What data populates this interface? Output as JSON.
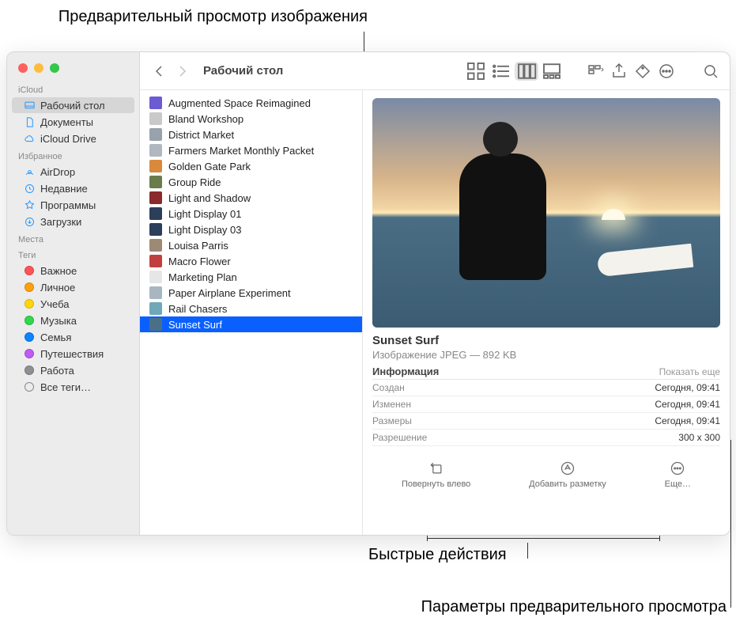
{
  "annotations": {
    "preview": "Предварительный просмотр изображения",
    "quick_actions": "Быстрые действия",
    "preview_options": "Параметры предварительного просмотра"
  },
  "toolbar": {
    "title": "Рабочий стол"
  },
  "sidebar": {
    "sections": {
      "icloud": {
        "label": "iCloud",
        "items": [
          "Рабочий стол",
          "Документы",
          "iCloud Drive"
        ]
      },
      "favorites": {
        "label": "Избранное",
        "items": [
          "AirDrop",
          "Недавние",
          "Программы",
          "Загрузки"
        ]
      },
      "places": {
        "label": "Места"
      },
      "tags": {
        "label": "Теги",
        "items": [
          "Важное",
          "Личное",
          "Учеба",
          "Музыка",
          "Семья",
          "Путешествия",
          "Работа"
        ],
        "all": "Все теги…"
      }
    },
    "tag_colors": [
      "#ff5257",
      "#ff9f0a",
      "#ffd60a",
      "#32d74b",
      "#0a84ff",
      "#bf5af2",
      "#8e8e93"
    ]
  },
  "files": [
    {
      "name": "Augmented Space Reimagined",
      "ico": "#6b5bd4"
    },
    {
      "name": "Bland Workshop",
      "ico": "#c9c9c9"
    },
    {
      "name": "District Market",
      "ico": "#97a2ad"
    },
    {
      "name": "Farmers Market Monthly Packet",
      "ico": "#b0b7bf"
    },
    {
      "name": "Golden Gate Park",
      "ico": "#d9893b"
    },
    {
      "name": "Group Ride",
      "ico": "#6a7b4c"
    },
    {
      "name": "Light and Shadow",
      "ico": "#8a2a2a"
    },
    {
      "name": "Light Display 01",
      "ico": "#2c3e5a"
    },
    {
      "name": "Light Display 03",
      "ico": "#2c3e5a"
    },
    {
      "name": "Louisa Parris",
      "ico": "#9d8a76"
    },
    {
      "name": "Macro Flower",
      "ico": "#c04040"
    },
    {
      "name": "Marketing Plan",
      "ico": "#e6e6e6"
    },
    {
      "name": "Paper Airplane Experiment",
      "ico": "#a8b6c2"
    },
    {
      "name": "Rail Chasers",
      "ico": "#6fa8b8"
    },
    {
      "name": "Sunset Surf",
      "ico": "#4c6f88",
      "selected": true
    }
  ],
  "preview": {
    "title": "Sunset Surf",
    "subtitle": "Изображение JPEG — 892 KB",
    "info_label": "Информация",
    "show_more": "Показать еще",
    "rows": [
      {
        "k": "Создан",
        "v": "Сегодня, 09:41"
      },
      {
        "k": "Изменен",
        "v": "Сегодня, 09:41"
      },
      {
        "k": "Размеры",
        "v": "Сегодня, 09:41"
      },
      {
        "k": "Разрешение",
        "v": "300 x 300"
      }
    ],
    "quick_actions": {
      "rotate": "Повернуть влево",
      "markup": "Добавить разметку",
      "more": "Еще…"
    }
  }
}
